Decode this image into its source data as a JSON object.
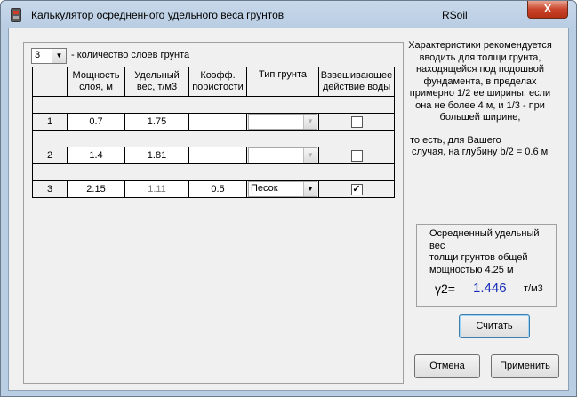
{
  "window": {
    "title": "Калькулятор осредненного удельного веса грунтов",
    "app_name": "RSoil",
    "close_label": "X"
  },
  "layers": {
    "count_value": "3",
    "count_label": "-  количество слоев грунта"
  },
  "table": {
    "headers": [
      "Мощность слоя, м",
      "Удельный вес, т/м3",
      "Коэфф. пористости",
      "Тип грунта",
      "Взвешивающее действие воды"
    ],
    "header_lines": [
      [
        "Мощность",
        "слоя, м"
      ],
      [
        "Удельный",
        "вес, т/м3"
      ],
      [
        "Коэфф.",
        "пористости"
      ],
      [
        "Тип грунта"
      ],
      [
        "Взвешивающее",
        "действие воды"
      ]
    ],
    "rows": [
      {
        "n": "1",
        "thickness": "0.7",
        "weight": "1.75",
        "porosity": "",
        "soil_type": "",
        "buoyancy": false
      },
      {
        "n": "2",
        "thickness": "1.4",
        "weight": "1.81",
        "porosity": "",
        "soil_type": "",
        "buoyancy": false
      },
      {
        "n": "3",
        "thickness": "2.15",
        "weight": "1.11",
        "porosity": "0.5",
        "soil_type": "Песок",
        "buoyancy": true
      }
    ]
  },
  "info": {
    "lines": [
      "Характеристики рекомендуется",
      "вводить для толщи грунта,",
      "находящейся под подошвой",
      "фундамента, в пределах",
      "примерно 1/2 ее ширины, если",
      "она не более 4 м, и 1/3 - при",
      "большей ширине,"
    ],
    "depth_line1": "то есть, для Вашего",
    "depth_line2": "случая,  на глубину b/2 = 0.6   м"
  },
  "result": {
    "line1": "Осредненный удельный вес",
    "line2": "толщи грунтов общей",
    "line3": "мощностью 4.25      м",
    "gamma_label": "γ2=",
    "gamma_value": "1.446",
    "gamma_unit": "т/м3"
  },
  "buttons": {
    "calculate": "Считать",
    "cancel": "Отмена",
    "apply": "Применить"
  }
}
